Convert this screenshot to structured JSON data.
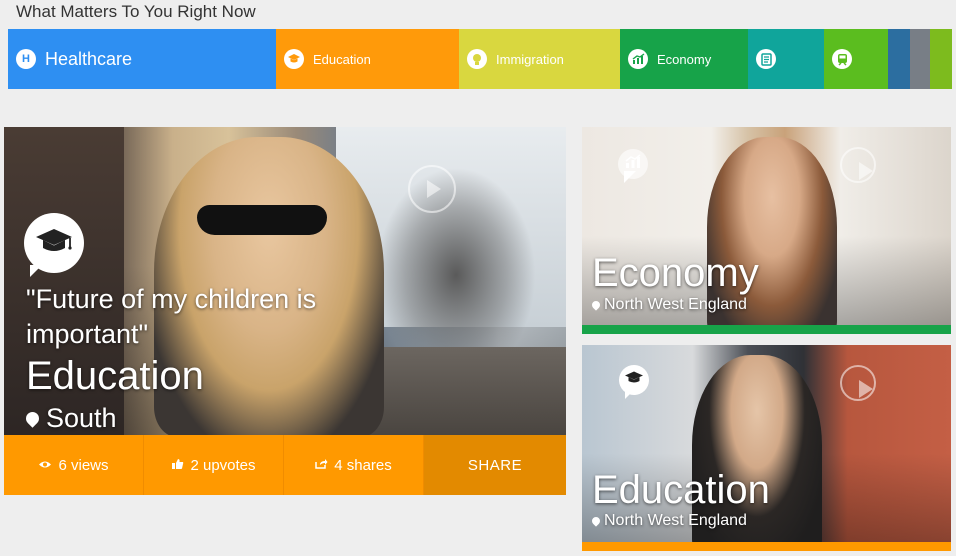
{
  "page": {
    "title": "What Matters To You Right Now"
  },
  "topics": [
    {
      "label": "Healthcare",
      "color": "#2e8ff2",
      "icon": "hospital-icon",
      "glyph": "H"
    },
    {
      "label": "Education",
      "color": "#ff9a0a",
      "icon": "graduation-cap-icon",
      "glyph": "🎓"
    },
    {
      "label": "Immigration",
      "color": "#d9d73f",
      "icon": "lightbulb-icon",
      "glyph": "✦"
    },
    {
      "label": "Economy",
      "color": "#17a349",
      "icon": "chart-icon",
      "glyph": "↗"
    },
    {
      "label": "",
      "color": "#10a59b",
      "icon": "document-icon",
      "glyph": "▤"
    },
    {
      "label": "",
      "color": "#5bbd1f",
      "icon": "train-icon",
      "glyph": "■"
    },
    {
      "label": "",
      "color": "#2c6ea0",
      "icon": "",
      "glyph": ""
    },
    {
      "label": "",
      "color": "#787e86",
      "icon": "",
      "glyph": ""
    },
    {
      "label": "",
      "color": "#7dbb1e",
      "icon": "",
      "glyph": ""
    }
  ],
  "featured": {
    "quote": "\"Future of my children is important\"",
    "topic": "Education",
    "location": "South",
    "icon": "graduation-cap-icon",
    "accent": "#ff9900",
    "stats": {
      "views": "6 views",
      "upvotes": "2 upvotes",
      "shares": "4 shares",
      "share_label": "SHARE"
    }
  },
  "side_videos": [
    {
      "topic": "Economy",
      "location": "North West England",
      "icon": "chart-icon",
      "accent": "#17a349"
    },
    {
      "topic": "Education",
      "location": "North West England",
      "icon": "graduation-cap-icon",
      "accent": "#ff9900"
    }
  ]
}
